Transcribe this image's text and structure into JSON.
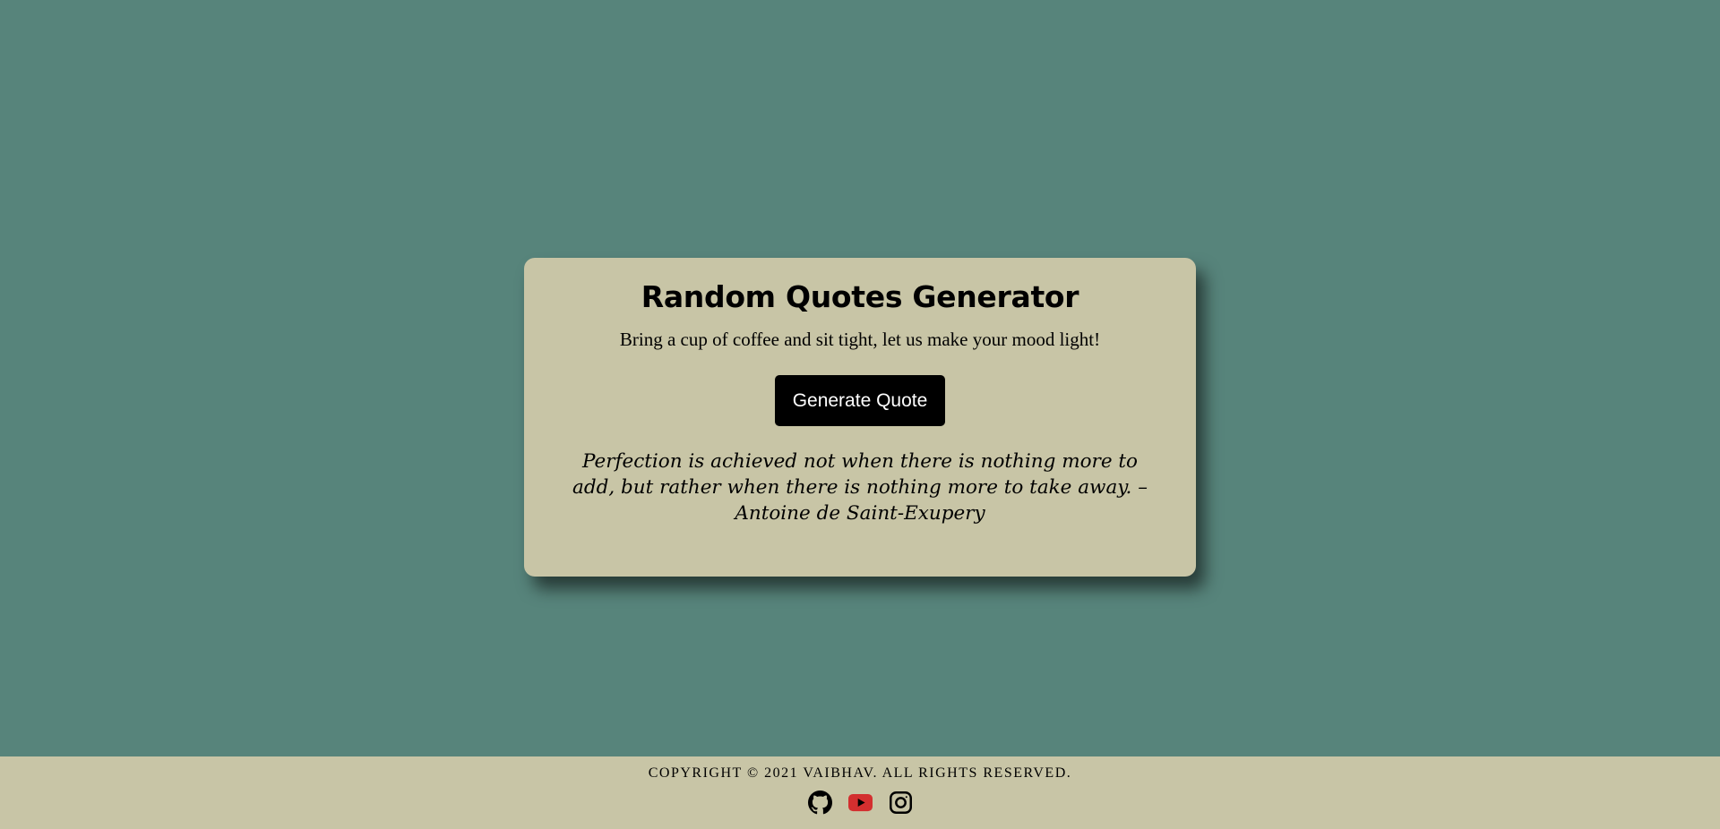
{
  "card": {
    "title": "Random Quotes Generator",
    "subtitle": "Bring a cup of coffee and sit tight, let us make your mood light!",
    "button_label": "Generate Quote",
    "quote": "Perfection is achieved not when there is nothing more to add, but rather when there is nothing more to take away. – Antoine de Saint-Exupery"
  },
  "footer": {
    "copyright": "COPYRIGHT © 2021 VAIBHAV. ALL RIGHTS RESERVED.",
    "socials": [
      {
        "icon": "github-icon"
      },
      {
        "icon": "youtube-icon"
      },
      {
        "icon": "instagram-icon"
      }
    ]
  },
  "colors": {
    "background": "#57847b",
    "card": "#c8c5a6",
    "button": "#000000",
    "youtube": "#d32f2f"
  }
}
